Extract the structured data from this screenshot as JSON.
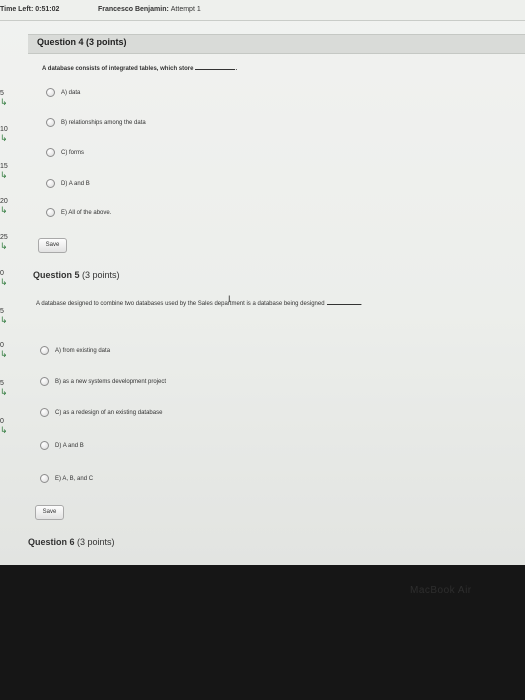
{
  "topbar": {
    "time_left_label": "Time Left:",
    "time_left_value": "0:51:02",
    "user_name": "Francesco Benjamin:",
    "attempt": "Attempt 1"
  },
  "rail": [
    "5",
    "10",
    "15",
    "20",
    "25",
    "0",
    "5",
    "0",
    "5",
    "0"
  ],
  "question4": {
    "title": "Question 4",
    "points": "(3 points)",
    "prompt": "A database consists of integrated tables, which store",
    "options": [
      {
        "letter": "A)",
        "text": "data"
      },
      {
        "letter": "B)",
        "text": "relationships among the data"
      },
      {
        "letter": "C)",
        "text": "forms"
      },
      {
        "letter": "D)",
        "text": "A and B"
      },
      {
        "letter": "E)",
        "text": "All of the above."
      }
    ],
    "save_label": "Save"
  },
  "question5": {
    "title": "Question 5",
    "points": "(3 points)",
    "prompt": "A database designed to combine two databases used by the Sales department is a database being designed",
    "options": [
      {
        "letter": "A)",
        "text": "from existing data"
      },
      {
        "letter": "B)",
        "text": "as a new systems development project"
      },
      {
        "letter": "C)",
        "text": "as a redesign of an existing database"
      },
      {
        "letter": "D)",
        "text": "A and B"
      },
      {
        "letter": "E)",
        "text": "A, B, and C"
      }
    ],
    "save_label": "Save"
  },
  "question6": {
    "title": "Question 6",
    "points": "(3 points)"
  },
  "laptop_brand": "MacBook Air",
  "icons": {
    "rail": "grade-arrow-icon",
    "radio": "radio-button-icon",
    "cursor": "text-cursor-icon"
  }
}
